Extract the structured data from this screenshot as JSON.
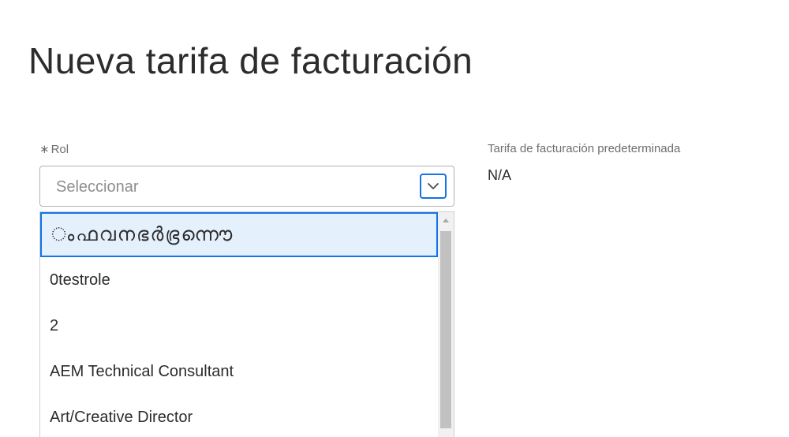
{
  "page": {
    "title": "Nueva tarifa de facturación"
  },
  "role_field": {
    "required_mark": "∗",
    "label": "Rol",
    "placeholder": "Seleccionar",
    "options": [
      "ംഫവനഭർഭ്രന്നൌ",
      "0testrole",
      "2",
      "AEM Technical Consultant",
      "Art/Creative Director"
    ],
    "highlighted_index": 0
  },
  "default_rate": {
    "label": "Tarifa de facturación predeterminada",
    "value": "N/A"
  },
  "colors": {
    "accent": "#1473e6",
    "highlight_bg": "#e5f0fd"
  },
  "icons": {
    "toggle": "chevron-down-icon"
  }
}
